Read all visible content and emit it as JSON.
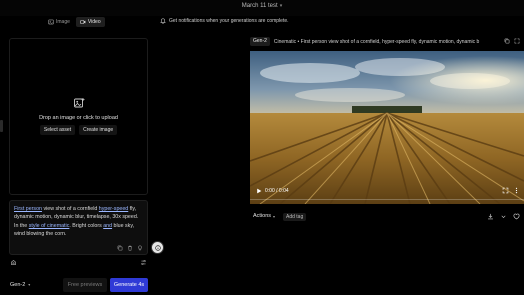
{
  "window": {
    "title": "March 11 test"
  },
  "mode_tabs": [
    {
      "label": "Image",
      "active": false,
      "icon": "image-icon"
    },
    {
      "label": "Video",
      "active": true,
      "icon": "video-icon"
    }
  ],
  "notification": {
    "text": "Get notifications when your generations are complete.",
    "icon": "bell-icon"
  },
  "upload": {
    "text": "Drop an image or click to upload",
    "select_asset": "Select asset",
    "create_image": "Create image",
    "icon": "image-upload-icon"
  },
  "prompt": {
    "segments": [
      {
        "text": "First person",
        "link": true
      },
      {
        "text": " view shot of a cornfield ",
        "link": false
      },
      {
        "text": "hyper-speed",
        "link": true
      },
      {
        "text": " fly, dynamic motion, dynamic blur, timelapse, 30x speed. In the ",
        "link": false
      },
      {
        "text": "style of cinematic",
        "link": true
      },
      {
        "text": ". Bright colors ",
        "link": false
      },
      {
        "text": "and",
        "link": true
      },
      {
        "text": " blue sky, wind blowing the corn.",
        "link": false
      }
    ]
  },
  "bottom": {
    "model": "Gen-2",
    "free_previews": "Free previews",
    "generate": "Generate 4s"
  },
  "result": {
    "model_chip": "Gen-2",
    "header_text": "Cinematic • First person view shot of a cornfield, hyper-speed fly, dynamic motion, dynamic b",
    "time": "0:00 / 0:04",
    "progress": 0.0,
    "actions_label": "Actions",
    "add_tag_label": "Add tag"
  },
  "colors": {
    "generate_button": "#2f3ad6",
    "link": "#9ab6ff",
    "background": "#000000"
  }
}
